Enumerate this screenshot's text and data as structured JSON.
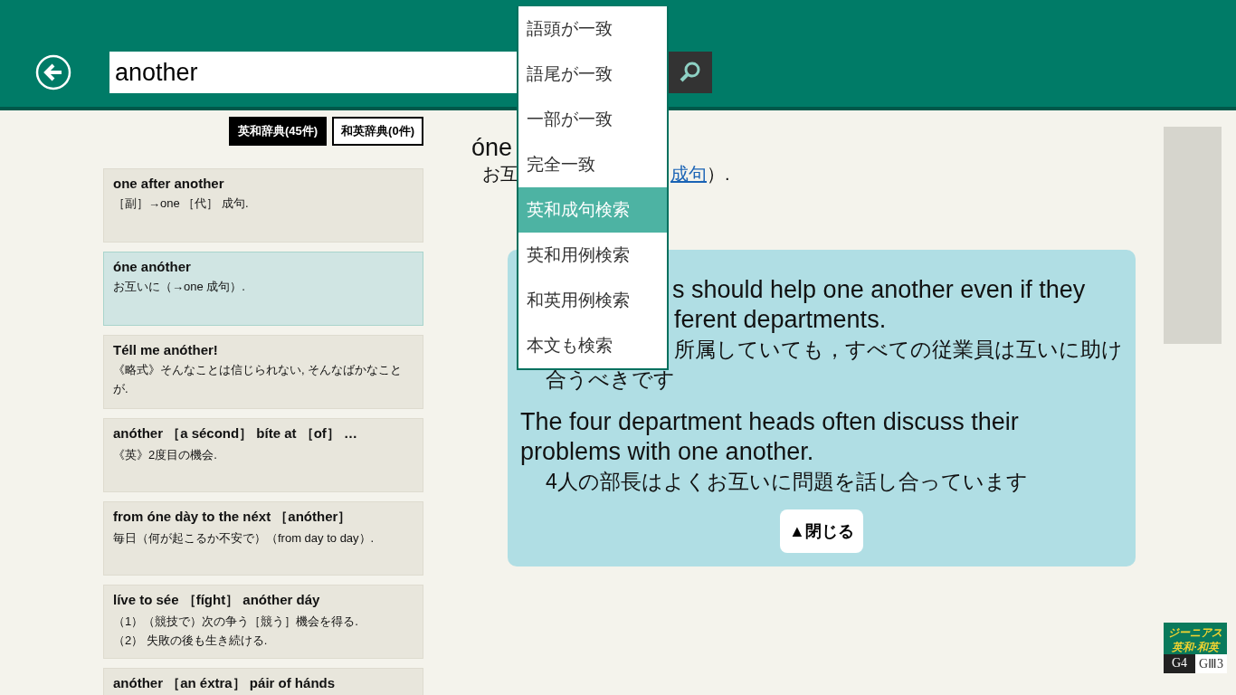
{
  "search": {
    "value": "another"
  },
  "match_menu": {
    "items": [
      {
        "label": "語頭が一致",
        "selected": false
      },
      {
        "label": "語尾が一致",
        "selected": false
      },
      {
        "label": "一部が一致",
        "selected": false
      },
      {
        "label": "完全一致",
        "selected": false
      },
      {
        "label": "英和成句検索",
        "selected": true
      },
      {
        "label": "英和用例検索",
        "selected": false
      },
      {
        "label": "和英用例検索",
        "selected": false
      },
      {
        "label": "本文も検索",
        "selected": false
      }
    ]
  },
  "dictionary_tabs": [
    {
      "label": "英和辞典(45件)",
      "selected": true
    },
    {
      "label": "和英辞典(0件)",
      "selected": false
    }
  ],
  "results": [
    {
      "title": "one after another",
      "body": "［副］→one ［代］ 成句.",
      "selected": false
    },
    {
      "title": "óne anóther",
      "body": "お互いに（→one 成句）.",
      "selected": true
    },
    {
      "title": "Téll me anóther!",
      "body": "《略式》そんなことは信じられない, そんなばかなことが.",
      "selected": false
    },
    {
      "title": "anóther ［a sécond］ bíte at ［of］ …",
      "body": "《英》2度目の機会.",
      "selected": false
    },
    {
      "title": "from óne dày to the néxt ［anóther］",
      "body": "毎日（何が起こるか不安で）（from day to day）.",
      "selected": false
    },
    {
      "title": "líve to sée ［fíght］ anóther dáy",
      "body": "（1）（競技で）次の争う［競う］機会を得る.\n（2） 失敗の後も生き続ける.",
      "selected": false
    },
    {
      "title": "anóther ［an éxtra］ páir of hánds",
      "selected": false
    }
  ],
  "detail": {
    "headword": "óne",
    "definition_start": "お互",
    "definition_link": "成句",
    "definition_end": "）.",
    "examples": [
      {
        "english_lines": [
          "s should help one another even if they",
          "ferent departments."
        ],
        "japanese_lines": [
          "所属していても，すべての従業員は互いに助け",
          "合うべきです"
        ],
        "partly_covered": true
      },
      {
        "english_lines": [
          "The four department heads often discuss their problems with one another."
        ],
        "japanese_lines": [
          "4人の部長はよくお互いに問題を話し合っています"
        ],
        "partly_covered": false
      }
    ],
    "close_button": "▲閉じる"
  },
  "logo": {
    "title": "ジーニアス",
    "subtitle": "英和·和英",
    "editions": [
      "G4",
      "GⅢ3"
    ]
  }
}
